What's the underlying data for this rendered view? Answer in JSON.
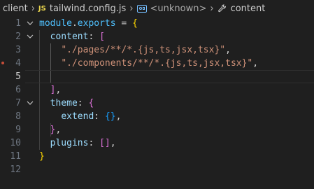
{
  "breadcrumb": {
    "items": [
      {
        "label": "client"
      },
      {
        "icon": "js-file-icon",
        "icon_text": "JS",
        "label": "tailwind.config.js"
      },
      {
        "icon": "module-icon",
        "label": "<unknown>"
      },
      {
        "icon": "wrench-icon",
        "label": "content"
      }
    ]
  },
  "editor": {
    "line_numbers": [
      "1",
      "2",
      "3",
      "4",
      "5",
      "6",
      "7",
      "8",
      "9",
      "10",
      "11",
      "12"
    ],
    "tokens": {
      "l1": {
        "a": "module",
        "b": ".",
        "c": "exports",
        "d": " = ",
        "e": "{"
      },
      "l2": {
        "a": "content",
        "b": ": ",
        "c": "["
      },
      "l3": {
        "a": "\"./pages/**/*.{js,ts,jsx,tsx}\"",
        "b": ","
      },
      "l4": {
        "a": "\"./components/**/*.{js,ts,jsx,tsx}\"",
        "b": ","
      },
      "l6": {
        "a": "]",
        "b": ","
      },
      "l7": {
        "a": "theme",
        "b": ": ",
        "c": "{"
      },
      "l8": {
        "a": "extend",
        "b": ": ",
        "c": "{}",
        "d": ","
      },
      "l9": {
        "a": "}",
        "b": ","
      },
      "l10": {
        "a": "plugins",
        "b": ": ",
        "c": "[]",
        "d": ","
      },
      "l11": {
        "a": "}"
      }
    }
  },
  "colors": {
    "background": "#1f1f1f",
    "line_number": "#6e7681",
    "string": "#ce9178",
    "property": "#9cdcfe",
    "variable": "#4fc1ff",
    "bracket_level1": "#ffd700",
    "bracket_level2": "#da70d6",
    "bracket_level3": "#179fff"
  }
}
